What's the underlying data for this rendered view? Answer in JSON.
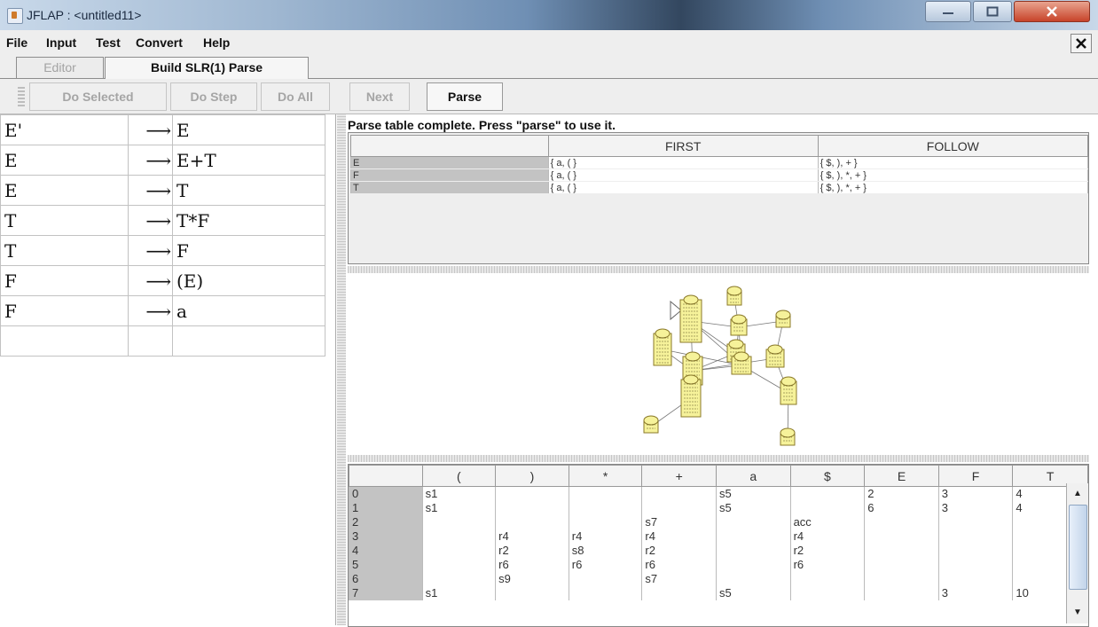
{
  "window": {
    "title": "JFLAP : <untitled11>"
  },
  "menu": [
    "File",
    "Input",
    "Test",
    "Convert",
    "Help"
  ],
  "tabs": {
    "editor": "Editor",
    "active": "Build SLR(1) Parse"
  },
  "toolbar": {
    "do_selected": "Do Selected",
    "do_step": "Do Step",
    "do_all": "Do All",
    "next": "Next",
    "parse": "Parse"
  },
  "grammar": [
    {
      "lhs": "E'",
      "arrow": "⟶",
      "rhs": "E"
    },
    {
      "lhs": "E",
      "arrow": "⟶",
      "rhs": "E+T"
    },
    {
      "lhs": "E",
      "arrow": "⟶",
      "rhs": "T"
    },
    {
      "lhs": "T",
      "arrow": "⟶",
      "rhs": "T*F"
    },
    {
      "lhs": "T",
      "arrow": "⟶",
      "rhs": "F"
    },
    {
      "lhs": "F",
      "arrow": "⟶",
      "rhs": "(E)"
    },
    {
      "lhs": "F",
      "arrow": "⟶",
      "rhs": "a"
    },
    {
      "lhs": "",
      "arrow": "",
      "rhs": ""
    }
  ],
  "status": "Parse table complete.  Press \"parse\" to use it.",
  "first_follow": {
    "headers": [
      "",
      "FIRST",
      "FOLLOW"
    ],
    "rows": [
      {
        "symbol": "E",
        "first": "{ a, ( }",
        "follow": "{ $, ), + }"
      },
      {
        "symbol": "F",
        "first": "{ a, ( }",
        "follow": "{ $, ), *, + }"
      },
      {
        "symbol": "T",
        "first": "{ a, ( }",
        "follow": "{ $, ), *, + }"
      }
    ]
  },
  "parse_table": {
    "headers": [
      "",
      "(",
      ")",
      "*",
      "+",
      "a",
      "$",
      "E",
      "F",
      "T"
    ],
    "rows": [
      [
        "0",
        "s1",
        "",
        "",
        "",
        "s5",
        "",
        "2",
        "3",
        "4"
      ],
      [
        "1",
        "s1",
        "",
        "",
        "",
        "s5",
        "",
        "6",
        "3",
        "4"
      ],
      [
        "2",
        "",
        "",
        "",
        "s7",
        "",
        "acc",
        "",
        "",
        ""
      ],
      [
        "3",
        "",
        "r4",
        "r4",
        "r4",
        "",
        "r4",
        "",
        "",
        ""
      ],
      [
        "4",
        "",
        "r2",
        "s8",
        "r2",
        "",
        "r2",
        "",
        "",
        ""
      ],
      [
        "5",
        "",
        "r6",
        "r6",
        "r6",
        "",
        "r6",
        "",
        "",
        ""
      ],
      [
        "6",
        "",
        "s9",
        "",
        "s7",
        "",
        "",
        "",
        "",
        ""
      ],
      [
        "7",
        "s1",
        "",
        "",
        "",
        "s5",
        "",
        "",
        "3",
        "10"
      ]
    ]
  },
  "colors": {
    "graph_node": "#f6f29a",
    "graph_node_border": "#8b7a2a",
    "row_header": "#c3c3c3"
  }
}
